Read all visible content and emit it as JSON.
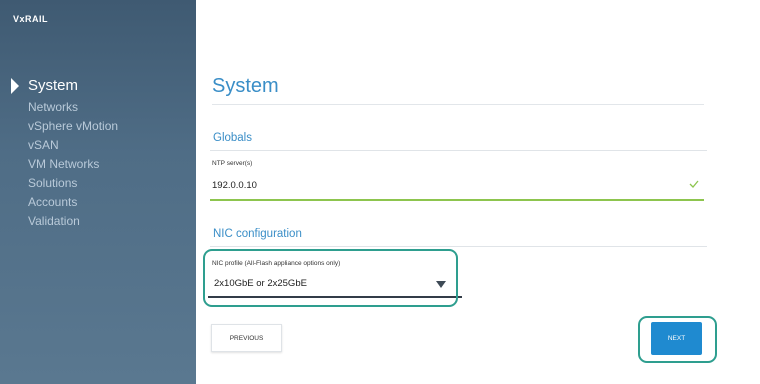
{
  "app": {
    "logo_text": "VxRAIL"
  },
  "sidebar": {
    "items": [
      {
        "label": "System",
        "active": true
      },
      {
        "label": "Networks",
        "active": false
      },
      {
        "label": "vSphere vMotion",
        "active": false
      },
      {
        "label": "vSAN",
        "active": false
      },
      {
        "label": "VM Networks",
        "active": false
      },
      {
        "label": "Solutions",
        "active": false
      },
      {
        "label": "Accounts",
        "active": false
      },
      {
        "label": "Validation",
        "active": false
      }
    ]
  },
  "main": {
    "title": "System",
    "globals": {
      "heading": "Globals",
      "ntp_label": "NTP server(s)",
      "ntp_value": "192.0.0.10",
      "ntp_valid": true
    },
    "nic": {
      "heading": "NIC configuration",
      "profile_label": "NIC profile (All-Flash appliance options only)",
      "profile_value": "2x10GbE or 2x25GbE"
    },
    "buttons": {
      "previous": "PREVIOUS",
      "next": "NEXT"
    }
  },
  "colors": {
    "accent": "#3a8ec7",
    "valid": "#8dc54e",
    "highlight": "#2e9e8f",
    "primary_button": "#1f8ad0",
    "sidebar": "#4f6d86"
  }
}
